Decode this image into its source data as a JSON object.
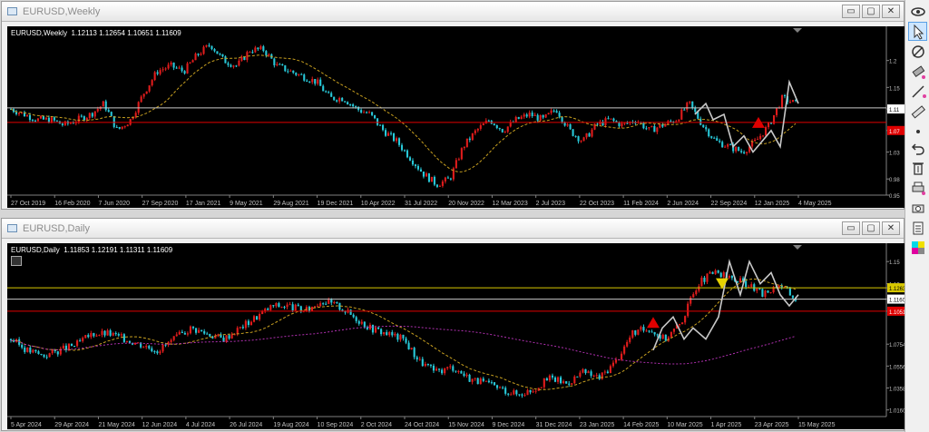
{
  "windows": [
    {
      "id": "weekly",
      "title": "EURUSD,Weekly",
      "header": "EURUSD,Weekly  1.12113 1.12654 1.10651 1.11609",
      "btn_min": "▭",
      "btn_max": "▢",
      "btn_close": "✕"
    },
    {
      "id": "daily",
      "title": "EURUSD,Daily",
      "header": "EURUSD,Daily  1.11853 1.12191 1.11311 1.11609",
      "btn_min": "▭",
      "btn_max": "▢",
      "btn_close": "✕"
    }
  ],
  "toolbar": {
    "items": [
      "eye-icon",
      "cursor-icon",
      "no-magnet-icon",
      "eraser-icon",
      "line-tool-icon",
      "ruler-icon",
      "dot-icon",
      "undo-icon",
      "trash-icon",
      "print-icon",
      "camera-icon",
      "clipboard-icon",
      "color-palette-icon"
    ]
  },
  "colors": {
    "bull": "#e01c1c",
    "bear": "#28c8d8",
    "ma_fast": "#c8a020",
    "ma_slow": "#b030b0",
    "price_line": "#c8c8c8",
    "red_level": "#e00000",
    "yellow_level": "#d8c800",
    "background": "#000000"
  },
  "chart_data": [
    {
      "type": "candlestick",
      "name": "EURUSD,Weekly",
      "y_tick_labels": [
        "1.2",
        "1.15",
        "1.11",
        "1.07",
        "1.03",
        "0.98",
        "0.95"
      ],
      "price_label": "1.11",
      "red_level_label": "1.07",
      "x_tick_labels": [
        "27 Oct 2019",
        "16 Feb 2020",
        "7 Jun 2020",
        "27 Sep 2020",
        "17 Jan 2021",
        "9 May 2021",
        "29 Aug 2021",
        "19 Dec 2021",
        "10 Apr 2022",
        "31 Jul 2022",
        "20 Nov 2022",
        "12 Mar 2023",
        "2 Jul 2023",
        "22 Oct 2023",
        "11 Feb 2024",
        "2 Jun 2024",
        "22 Sep 2024",
        "12 Jan 2025",
        "4 May 2025"
      ],
      "ylim": [
        0.95,
        1.25
      ],
      "close_path": [
        1.11,
        1.1,
        1.09,
        1.09,
        1.08,
        1.09,
        1.1,
        1.12,
        1.07,
        1.09,
        1.14,
        1.18,
        1.19,
        1.18,
        1.21,
        1.23,
        1.2,
        1.19,
        1.22,
        1.22,
        1.19,
        1.18,
        1.17,
        1.16,
        1.13,
        1.13,
        1.11,
        1.1,
        1.07,
        1.05,
        1.02,
        0.99,
        0.97,
        0.98,
        1.04,
        1.07,
        1.09,
        1.07,
        1.09,
        1.1,
        1.09,
        1.11,
        1.07,
        1.05,
        1.08,
        1.09,
        1.08,
        1.09,
        1.07,
        1.08,
        1.09,
        1.12,
        1.08,
        1.05,
        1.04,
        1.03,
        1.05,
        1.08,
        1.13,
        1.12
      ]
    },
    {
      "type": "candlestick",
      "name": "EURUSD,Daily",
      "y_tick_labels": [
        "1.15",
        "1.13",
        "1.12632",
        "1.11609",
        "1.10518",
        "1.07540",
        "1.05560",
        "1.03580",
        "1.01600"
      ],
      "price_label": "1.11609",
      "yellow_level_label": "1.12632",
      "red_level_label": "1.10518",
      "x_tick_labels": [
        "5 Apr 2024",
        "29 Apr 2024",
        "21 May 2024",
        "12 Jun 2024",
        "4 Jul 2024",
        "26 Jul 2024",
        "19 Aug 2024",
        "10 Sep 2024",
        "2 Oct 2024",
        "24 Oct 2024",
        "15 Nov 2024",
        "9 Dec 2024",
        "31 Dec 2024",
        "23 Jan 2025",
        "14 Feb 2025",
        "10 Mar 2025",
        "1 Apr 2025",
        "23 Apr 2025",
        "15 May 2025"
      ],
      "ylim": [
        1.01,
        1.16
      ],
      "close_path": [
        1.08,
        1.07,
        1.065,
        1.07,
        1.075,
        1.085,
        1.085,
        1.08,
        1.075,
        1.07,
        1.08,
        1.09,
        1.085,
        1.08,
        1.09,
        1.1,
        1.11,
        1.11,
        1.105,
        1.115,
        1.11,
        1.1,
        1.09,
        1.085,
        1.08,
        1.06,
        1.05,
        1.055,
        1.045,
        1.04,
        1.035,
        1.03,
        1.035,
        1.045,
        1.04,
        1.05,
        1.045,
        1.06,
        1.085,
        1.09,
        1.08,
        1.095,
        1.13,
        1.14,
        1.135,
        1.13,
        1.12,
        1.13,
        1.116
      ]
    }
  ]
}
